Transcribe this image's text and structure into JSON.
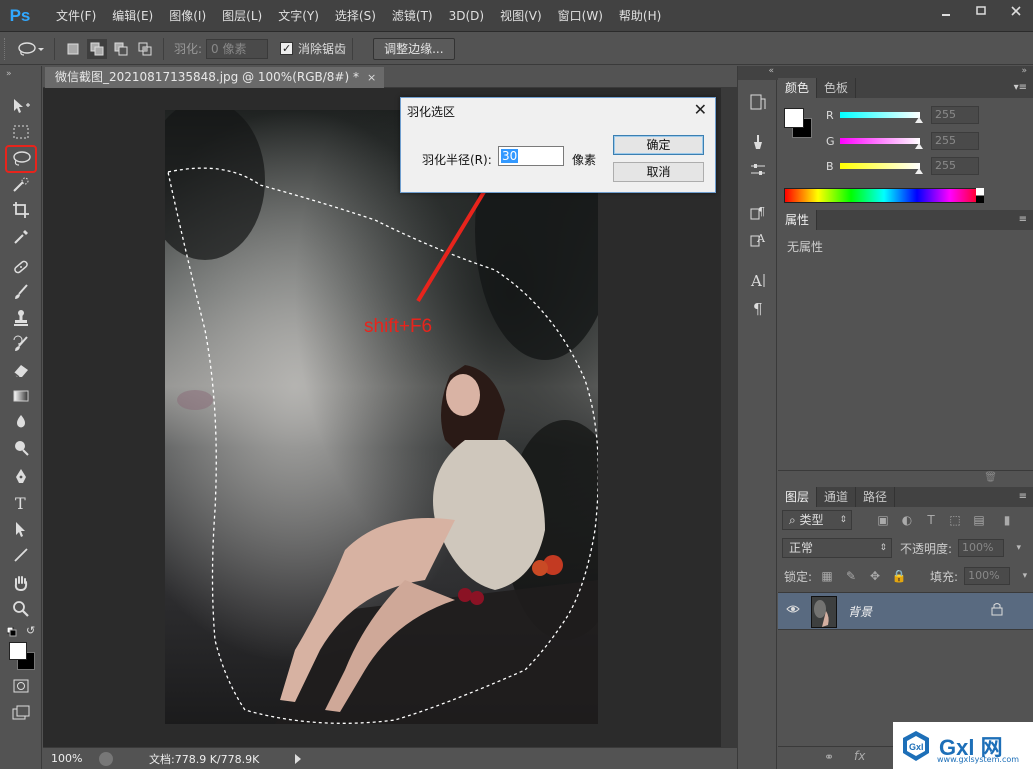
{
  "app": {
    "logo": "Ps",
    "menu": [
      "文件(F)",
      "编辑(E)",
      "图像(I)",
      "图层(L)",
      "文字(Y)",
      "选择(S)",
      "滤镜(T)",
      "3D(D)",
      "视图(V)",
      "窗口(W)",
      "帮助(H)"
    ]
  },
  "options": {
    "feather_label": "羽化:",
    "feather_value": "0 像素",
    "antialias_label": "消除锯齿",
    "antialias_checked": true,
    "refine_edge_button": "调整边缘..."
  },
  "document": {
    "tab_title": "微信截图_20210817135848.jpg @ 100%(RGB/8#) *",
    "tab_close": "×",
    "zoom": "100%",
    "doc_size": "文档:778.9 K/778.9K"
  },
  "annotation": {
    "shortcut_text": "shift+F6",
    "color": "#e8241c"
  },
  "dialog": {
    "title": "羽化选区",
    "radius_label": "羽化半径(R):",
    "radius_value": "30",
    "unit": "像素",
    "ok_button": "确定",
    "cancel_button": "取消"
  },
  "color_panel": {
    "tabs": [
      "颜色",
      "色板"
    ],
    "channels": [
      {
        "letter": "R",
        "value": "255"
      },
      {
        "letter": "G",
        "value": "255"
      },
      {
        "letter": "B",
        "value": "255"
      }
    ]
  },
  "properties_panel": {
    "tab": "属性",
    "empty_text": "无属性"
  },
  "layers_panel": {
    "tabs": [
      "图层",
      "通道",
      "路径"
    ],
    "filter_kind": "类型",
    "blend_mode": "正常",
    "opacity_label": "不透明度:",
    "opacity_value": "100%",
    "lock_label": "锁定:",
    "fill_label": "填充:",
    "fill_value": "100%",
    "layers": [
      {
        "name": "背景",
        "visible": true,
        "locked": true
      }
    ]
  },
  "watermark": {
    "brand": "Gxl 网",
    "url": "www.gxlsystem.com"
  }
}
